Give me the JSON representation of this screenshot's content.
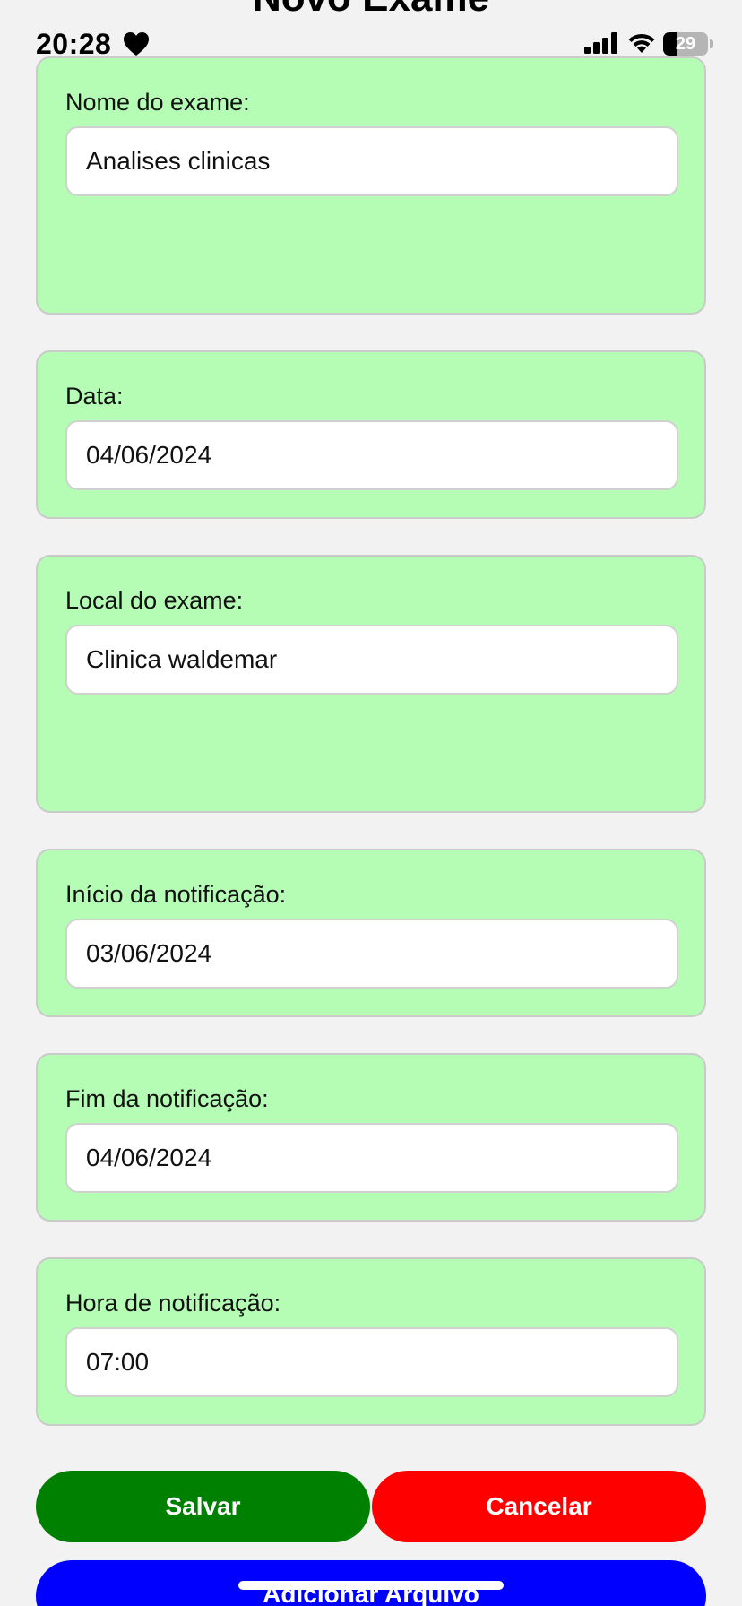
{
  "header": {
    "title": "Novo Exame"
  },
  "status_bar": {
    "time": "20:28",
    "battery": "29",
    "battery_level": 0.29
  },
  "fields": {
    "nome": {
      "label": "Nome do exame:",
      "value": "Analises clinicas"
    },
    "data": {
      "label": "Data:",
      "value": "04/06/2024"
    },
    "local": {
      "label": "Local do exame:",
      "value": "Clinica waldemar"
    },
    "inicio": {
      "label": "Início da notificação:",
      "value": "03/06/2024"
    },
    "fim": {
      "label": "Fim da notificação:",
      "value": "04/06/2024"
    },
    "hora": {
      "label": "Hora de notificação:",
      "value": "07:00"
    }
  },
  "buttons": {
    "save": "Salvar",
    "cancel": "Cancelar",
    "add_file": "Adicionar Arquivo"
  },
  "colors": {
    "card_bg": "#b5fcb4",
    "save": "#008000",
    "cancel": "#ff0000",
    "add_file": "#0000ff"
  }
}
